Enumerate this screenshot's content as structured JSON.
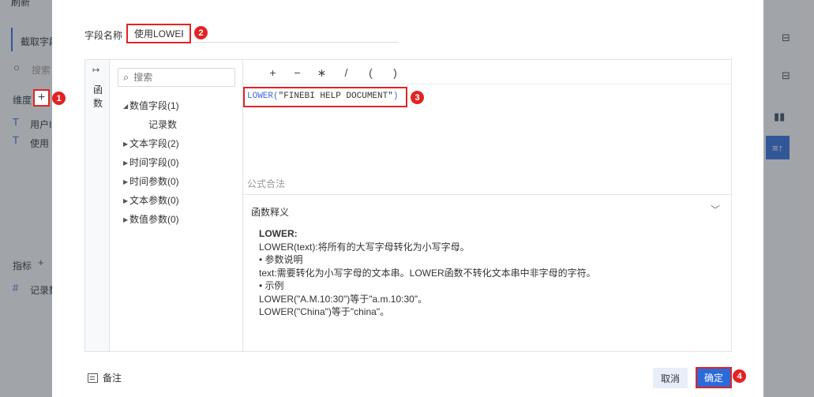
{
  "background": {
    "top_text": "刷新",
    "tab_text": "截取字段",
    "search_text": "搜索",
    "dimension_label": "维度",
    "dim_items": [
      "用户I",
      "使用"
    ],
    "metric_label": "指标",
    "metric_items": [
      "记录数"
    ]
  },
  "dialog": {
    "field_name_label": "字段名称",
    "field_name_value": "使用LOWER",
    "function_tab": "函数",
    "search_placeholder": "搜索",
    "tree": [
      {
        "label": "数值字段(1)",
        "expanded": true
      },
      {
        "label": "记录数",
        "child": true
      },
      {
        "label": "文本字段(2)"
      },
      {
        "label": "时间字段(0)"
      },
      {
        "label": "时间参数(0)"
      },
      {
        "label": "文本参数(0)"
      },
      {
        "label": "数值参数(0)"
      }
    ],
    "operators": [
      "+",
      "−",
      "∗",
      "/",
      "(",
      ")"
    ],
    "formula_fn": "LOWER(",
    "formula_str": "\"FINEBI HELP DOCUMENT\"",
    "formula_close": ")",
    "validity": "公式合法",
    "explain_title": "函数释义",
    "explain": {
      "name": "LOWER:",
      "line1": "LOWER(text):将所有的大写字母转化为小写字母。",
      "line2": "• 参数说明",
      "line3": "text:需要转化为小写字母的文本串。LOWER函数不转化文本串中非字母的字符。",
      "line4": "• 示例",
      "line5": "LOWER(\"A.M.10:30\")等于\"a.m.10:30\"。",
      "line6": "LOWER(\"China\")等于\"china\"。"
    },
    "note_label": "备注",
    "cancel_label": "取消",
    "ok_label": "确定"
  },
  "badges": [
    "1",
    "2",
    "3",
    "4"
  ],
  "colors": {
    "highlight": "#e02424",
    "primary": "#2a6ad9",
    "formula": "#3c6ad6"
  }
}
